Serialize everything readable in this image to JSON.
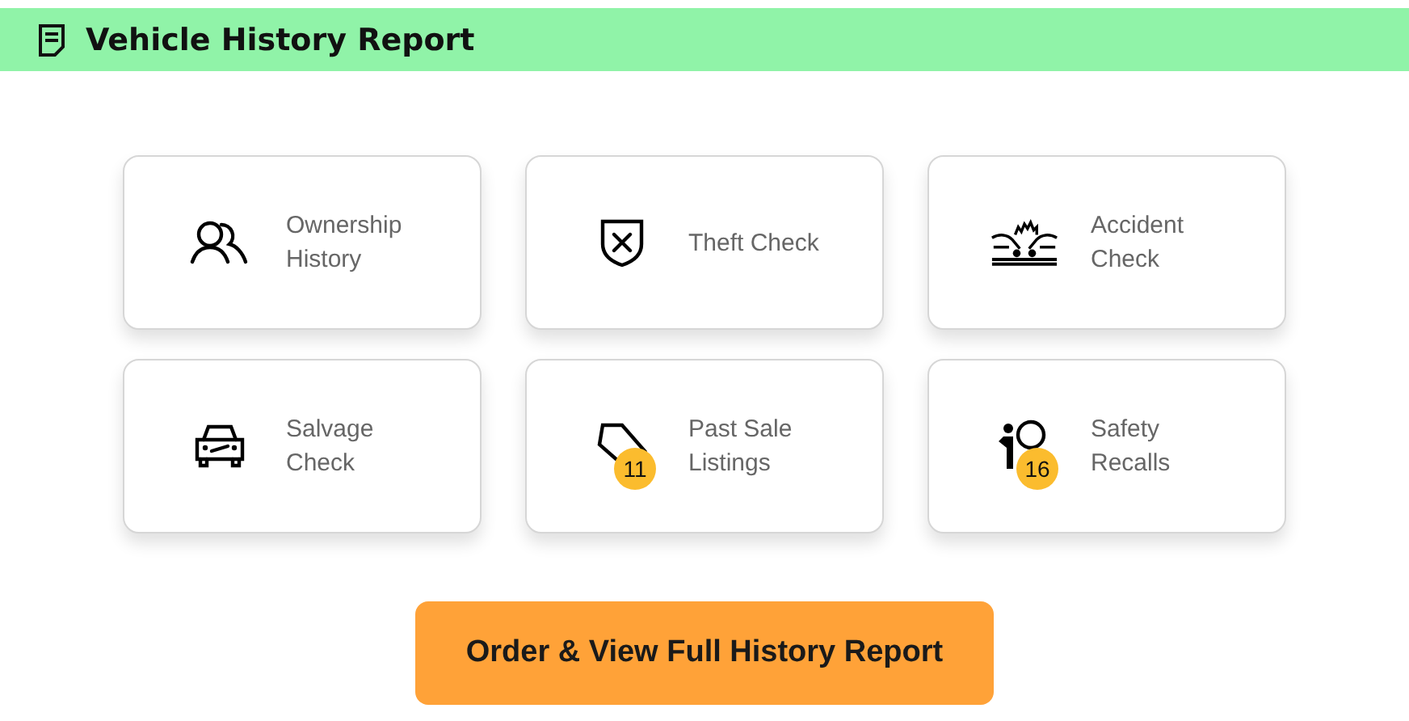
{
  "header": {
    "title": "Vehicle History Report"
  },
  "cards": [
    {
      "label": [
        "Ownership",
        "History"
      ]
    },
    {
      "label": [
        "Theft Check"
      ]
    },
    {
      "label": [
        "Accident",
        "Check"
      ]
    },
    {
      "label": [
        "Salvage",
        "Check"
      ]
    },
    {
      "label": [
        "Past Sale",
        "Listings"
      ],
      "badge": "11"
    },
    {
      "label": [
        "Safety",
        "Recalls"
      ],
      "badge": "16"
    }
  ],
  "button": {
    "label": "Order & View Full History Report"
  }
}
